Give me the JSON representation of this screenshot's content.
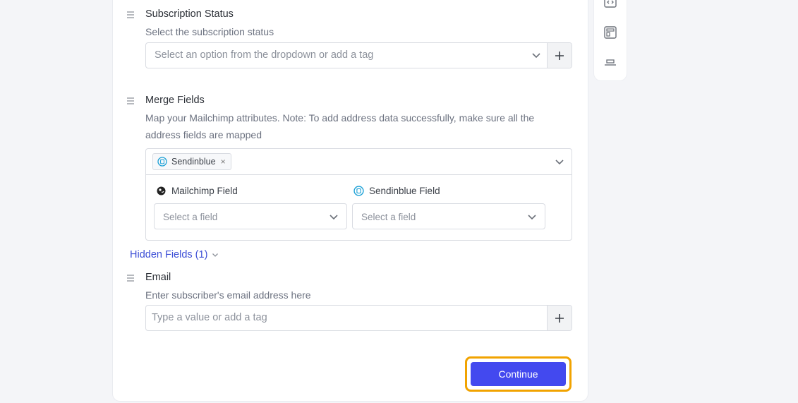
{
  "subscription": {
    "label": "Subscription Status",
    "description": "Select the subscription status",
    "placeholder": "Select an option from the dropdown or add a tag"
  },
  "merge": {
    "label": "Merge Fields",
    "description_line1": "Map your Mailchimp attributes. Note: To add address data successfully, make sure all the",
    "description_line2": "address fields are mapped",
    "chip_label": "Sendinblue",
    "chip_close": "×",
    "left_column_label": "Mailchimp Field",
    "right_column_label": "Sendinblue Field",
    "left_placeholder": "Select a field",
    "right_placeholder": "Select a field"
  },
  "hidden_fields": {
    "label": "Hidden Fields (1)"
  },
  "email": {
    "label": "Email",
    "description": "Enter subscriber's email address here",
    "placeholder": "Type a value or add a tag"
  },
  "footer": {
    "continue_label": "Continue"
  },
  "colors": {
    "accent": "#4349ef",
    "focus_ring": "#f1a300",
    "link": "#3d4fd6"
  }
}
